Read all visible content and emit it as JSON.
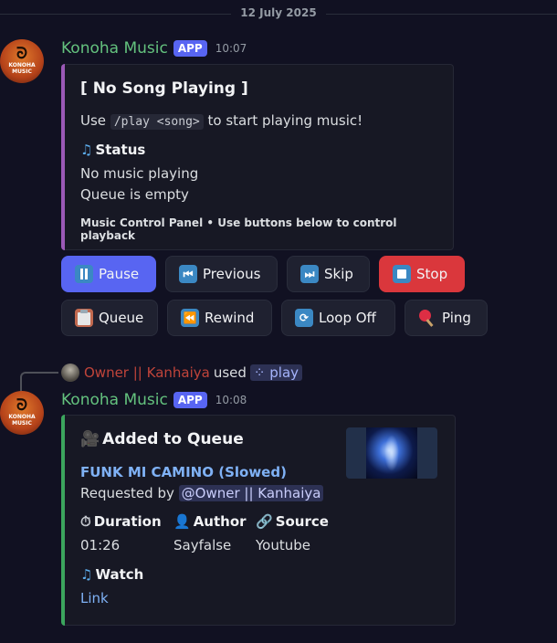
{
  "date_divider": "12 July 2025",
  "colors": {
    "success_bar": "#3ba55d",
    "purple_bar": "#9b59b6",
    "primary": "#5865f2",
    "danger": "#da373c",
    "username": "#64c27e"
  },
  "bot": {
    "name": "Konoha Music",
    "badge": "APP",
    "avatar_text": "KONOHA\nMUSIC",
    "avatar_icon": "leaf-village-symbol"
  },
  "message1": {
    "time": "10:07",
    "embed": {
      "title": "[ No Song Playing ]",
      "desc_prefix": "Use",
      "desc_code": "/play <song>",
      "desc_suffix": "to start playing music!",
      "status_name": "Status",
      "status_line1": "No music playing",
      "status_line2": "Queue is empty",
      "footer": "Music Control Panel • Use buttons below to control playback"
    },
    "buttons": {
      "pause": "Pause",
      "previous": "Previous",
      "skip": "Skip",
      "stop": "Stop",
      "queue": "Queue",
      "rewind": "Rewind",
      "loop": "Loop Off",
      "ping": "Ping"
    }
  },
  "reply": {
    "user": "Owner || Kanhaiya",
    "used": "used",
    "command": "play"
  },
  "message2": {
    "time": "10:08",
    "embed": {
      "title": "Added to Queue",
      "song": "FUNK MI CAMINO (Slowed)",
      "requested_by": "Requested by",
      "mention": "@Owner || Kanhaiya",
      "duration_name": "Duration",
      "duration_val": "01:26",
      "author_name": "Author",
      "author_val": "Sayfalse",
      "source_name": "Source",
      "source_val": "Youtube",
      "watch_name": "Watch",
      "watch_link": "Link"
    }
  }
}
